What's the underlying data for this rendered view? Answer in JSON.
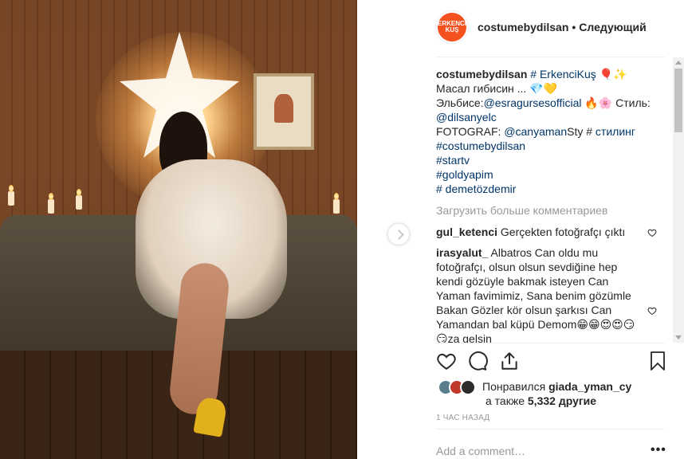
{
  "post": {
    "username": "costumebydilsan",
    "separator": "•",
    "follow_label": "Следующий",
    "avatar_logo_line1": "ERKENCİ",
    "avatar_logo_line2": "KUŞ"
  },
  "caption": {
    "username": "costumebydilsan",
    "tag1": "# ErkenciKuş",
    "emoji1": "🎈✨",
    "line2": "Масал гибисин ... 💎💛",
    "line3_prefix": "Эльбисе:",
    "mention1": "@esragursesofficial",
    "line3_suffix": " 🔥🌸 Стиль:",
    "mention2": "@dilsanyelc",
    "line5_prefix": "FOTOGRAF: ",
    "mention3": "@canyaman",
    "line5_mid": "Sty # ",
    "tag2": "стилинг",
    "tag3": "#costumebydilsan",
    "tag4": "#startv",
    "tag5": "#goldyapim",
    "tag6": "# demetözdemir"
  },
  "load_more_label": "Загрузить больше комментариев",
  "comments": [
    {
      "user": "gul_ketenci",
      "text": "Gerçekten fotoğrafçı çıktı"
    },
    {
      "user": "irasyalut_",
      "text": "Albatros Can oldu mu fotoğrafçı, olsun olsun sevdiğine hep kendi gözüyle bakmak isteyen Can Yaman favimimiz, Sana benim gözümle Bakan Gözler kör olsun şarkısı Can Yamandan bal küpü Demom😁😁😍😍😏😏za gelsin"
    }
  ],
  "likes": {
    "prefix": "Понравился ",
    "user": "giada_yman_cy",
    "line2_prefix": "а также ",
    "count": "5,332 другие"
  },
  "timestamp": "1 час назад",
  "add_comment_placeholder": "Add a comment…",
  "more_dots": "•••",
  "icons": [
    "heart-icon",
    "comment-icon",
    "share-icon",
    "bookmark-icon",
    "next-arrow-icon"
  ],
  "colors": {
    "link": "#003569",
    "muted": "#999999",
    "brand_logo": "#f4511e"
  }
}
